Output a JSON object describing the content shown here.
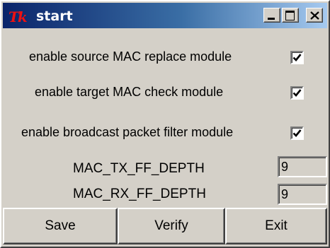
{
  "window": {
    "logo_text": "Tk",
    "title": "start"
  },
  "options": [
    {
      "label": "enable source MAC replace module",
      "checked": true
    },
    {
      "label": "enable target MAC check module",
      "checked": true
    },
    {
      "label": "enable broadcast packet filter module",
      "checked": true
    }
  ],
  "fields": [
    {
      "label": "MAC_TX_FF_DEPTH",
      "value": "9"
    },
    {
      "label": "MAC_RX_FF_DEPTH",
      "value": "9"
    }
  ],
  "buttons": {
    "save": "Save",
    "verify": "Verify",
    "exit": "Exit"
  },
  "colors": {
    "titlebar_start": "#0a246a",
    "titlebar_end": "#a6caf0",
    "face": "#d4d0c8",
    "logo": "#ee1111"
  }
}
